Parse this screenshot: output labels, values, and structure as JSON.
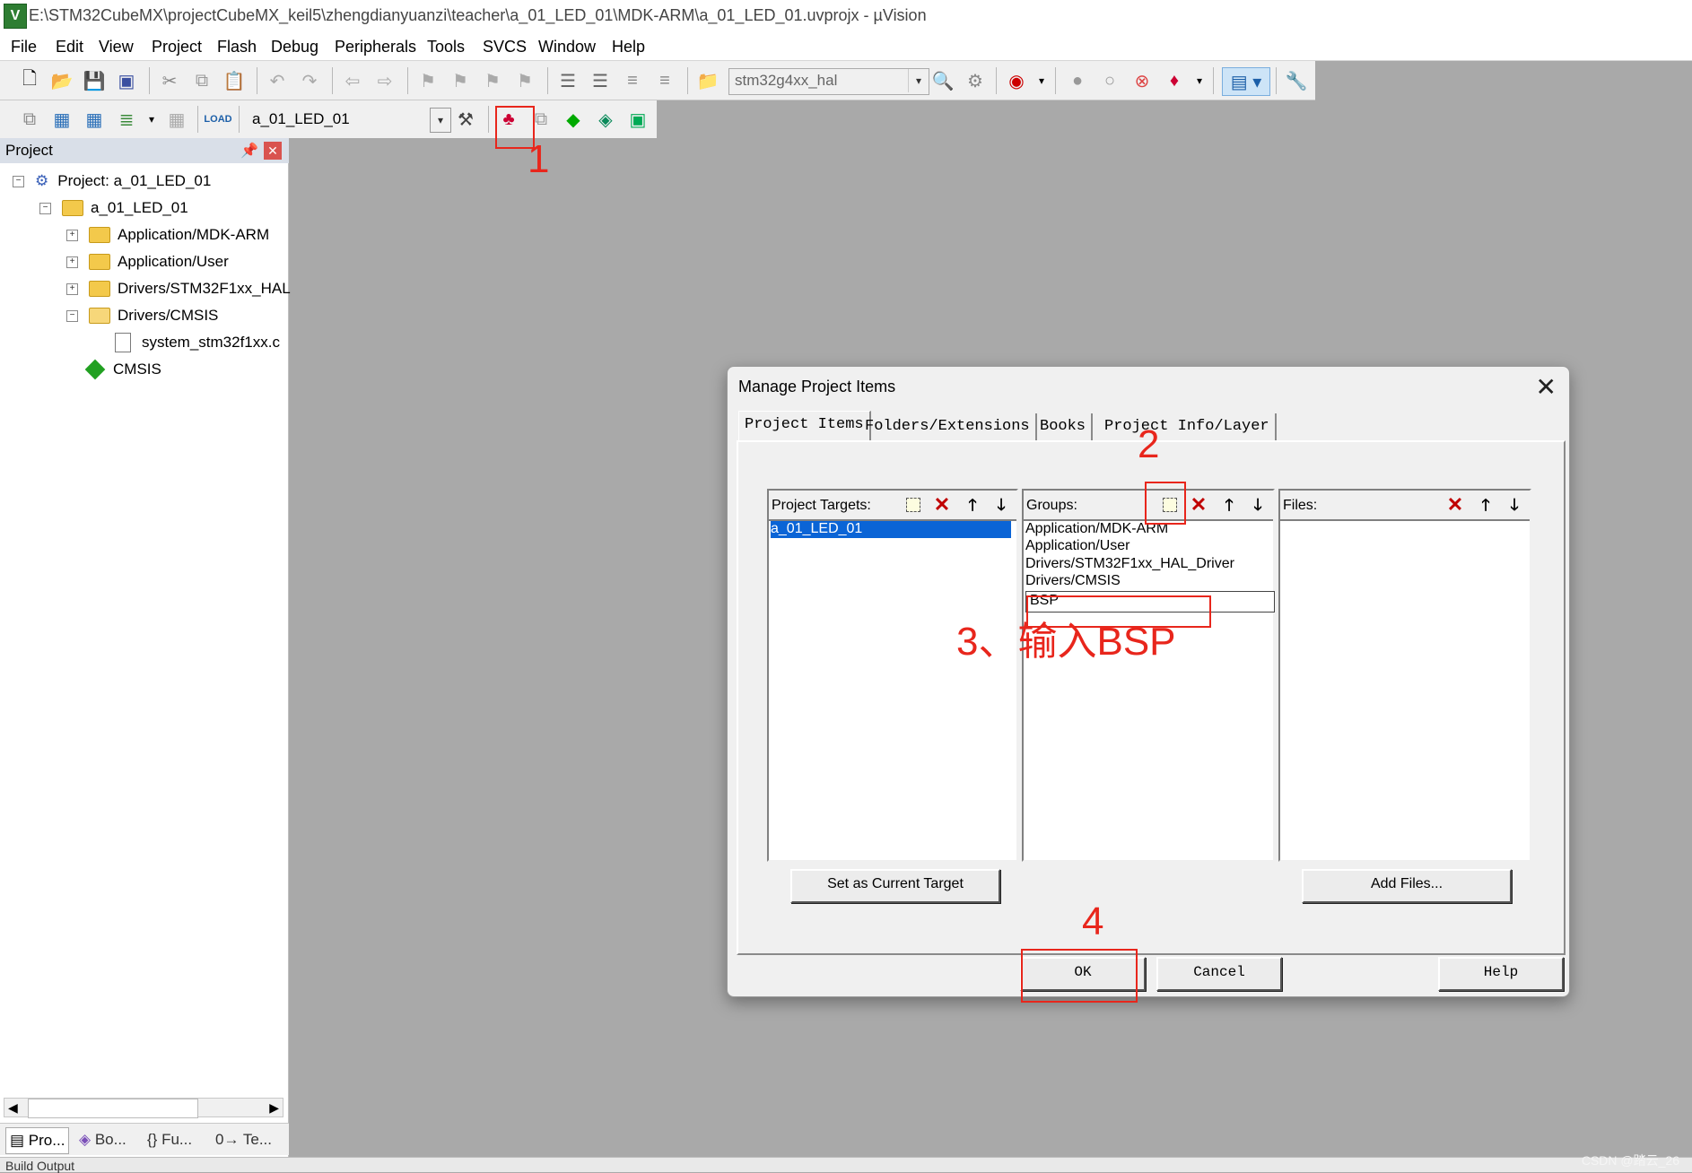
{
  "window": {
    "title": "E:\\STM32CubeMX\\projectCubeMX_keil5\\zhengdianyuanzi\\teacher\\a_01_LED_01\\MDK-ARM\\a_01_LED_01.uvprojx - µVision"
  },
  "menu": [
    "File",
    "Edit",
    "View",
    "Project",
    "Flash",
    "Debug",
    "Peripherals",
    "Tools",
    "SVCS",
    "Window",
    "Help"
  ],
  "toolbar": {
    "find_combo": "stm32g4xx_hal",
    "target_combo": "a_01_LED_01"
  },
  "project_panel": {
    "title": "Project",
    "tree": {
      "root": "Project: a_01_LED_01",
      "target": "a_01_LED_01",
      "groups": [
        "Application/MDK-ARM",
        "Application/User",
        "Drivers/STM32F1xx_HAL",
        "Drivers/CMSIS"
      ],
      "file": "system_stm32f1xx.c",
      "cmsis": "CMSIS"
    },
    "tabs": [
      "Pro...",
      "Bo...",
      "{} Fu...",
      "0→ Te..."
    ]
  },
  "status": {
    "text": "Build Output"
  },
  "dialog": {
    "title": "Manage Project Items",
    "tabs": [
      "Project Items",
      "Folders/Extensions",
      "Books",
      "Project Info/Layer"
    ],
    "targets": {
      "label": "Project Targets:",
      "items": [
        "a_01_LED_01"
      ]
    },
    "groups": {
      "label": "Groups:",
      "items": [
        "Application/MDK-ARM",
        "Application/User",
        "Drivers/STM32F1xx_HAL_Driver",
        "Drivers/CMSIS"
      ],
      "editing": "BSP"
    },
    "files": {
      "label": "Files:"
    },
    "buttons": {
      "set_target": "Set as Current Target",
      "add_files": "Add Files...",
      "ok": "OK",
      "cancel": "Cancel",
      "help": "Help"
    }
  },
  "annotations": {
    "a1": "1",
    "a2": "2",
    "a3": "3、输入BSP",
    "a4": "4"
  },
  "watermark": "CSDN @踏云_26"
}
